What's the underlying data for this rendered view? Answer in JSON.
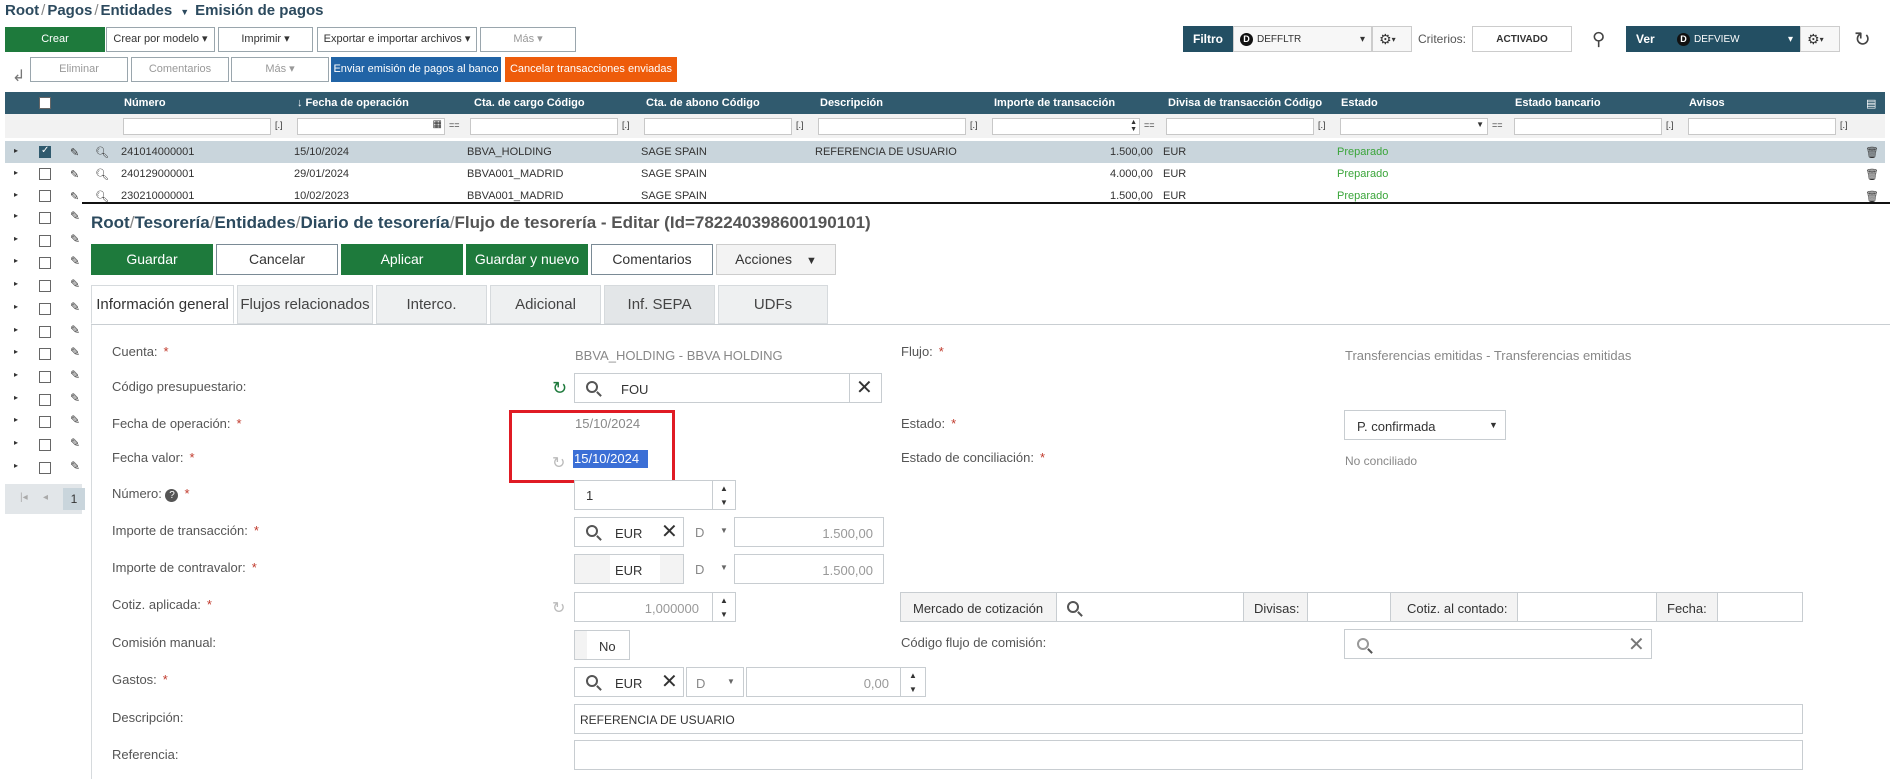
{
  "top_window": {
    "breadcrumb": [
      "Root",
      "Pagos",
      "Entidades",
      "Emisión de pagos"
    ],
    "toolbar1": {
      "crear": "Crear",
      "crear_modelo": "Crear por modelo",
      "imprimir": "Imprimir",
      "exportar": "Exportar e importar archivos",
      "mas": "Más"
    },
    "toolbar2": {
      "eliminar": "Eliminar",
      "comentarios": "Comentarios",
      "mas": "Más",
      "enviar": "Enviar emisión de pagos al banco",
      "cancelar": "Cancelar transacciones enviadas"
    },
    "filter": {
      "label": "Filtro",
      "badge": "D",
      "value": "DEFFLTR",
      "criterios_label": "Criterios:",
      "criterios_value": "ACTIVADO"
    },
    "view": {
      "label": "Ver",
      "badge": "D",
      "value": "DEFVIEW"
    },
    "columns": [
      "Número",
      "↓ Fecha de operación",
      "Cta. de cargo Código",
      "Cta. de abono Código",
      "Descripción",
      "Importe de transacción",
      "Divisa de transacción Código",
      "Estado",
      "Estado bancario",
      "Avisos"
    ],
    "filter_ops": [
      "[.]",
      "=="
    ],
    "rows": [
      {
        "numero": "241014000001",
        "fecha": "15/10/2024",
        "cargo": "BBVA_HOLDING",
        "abono": "SAGE SPAIN",
        "desc": "REFERENCIA DE USUARIO",
        "importe": "1.500,00",
        "divisa": "EUR",
        "estado": "Preparado"
      },
      {
        "numero": "240129000001",
        "fecha": "29/01/2024",
        "cargo": "BBVA001_MADRID",
        "abono": "SAGE SPAIN",
        "desc": "",
        "importe": "4.000,00",
        "divisa": "EUR",
        "estado": "Preparado"
      },
      {
        "numero": "230210000001",
        "fecha": "10/02/2023",
        "cargo": "BBVA001_MADRID",
        "abono": "SAGE SPAIN",
        "desc": "",
        "importe": "1.500,00",
        "divisa": "EUR",
        "estado": "Preparado"
      }
    ],
    "pager": "1"
  },
  "editor": {
    "breadcrumb": [
      "Root",
      "Tesorería",
      "Entidades",
      "Diario de tesorería"
    ],
    "title": "Flujo de tesorería - Editar (Id=782240398600190101)",
    "actions": {
      "guardar": "Guardar",
      "cancelar": "Cancelar",
      "aplicar": "Aplicar",
      "guardar_nuevo": "Guardar y nuevo",
      "comentarios": "Comentarios",
      "acciones": "Acciones"
    },
    "tabs": [
      "Información general",
      "Flujos relacionados",
      "Interco.",
      "Adicional",
      "Inf. SEPA",
      "UDFs"
    ],
    "labels": {
      "cuenta": "Cuenta:",
      "presupuestario": "Código presupuestario:",
      "fecha_op": "Fecha de operación:",
      "fecha_valor": "Fecha valor:",
      "numero": "Número:",
      "importe_trans": "Importe de transacción:",
      "importe_contra": "Importe de contravalor:",
      "cotiz": "Cotiz. aplicada:",
      "comision": "Comisión manual:",
      "gastos": "Gastos:",
      "descripcion": "Descripción:",
      "referencia": "Referencia:",
      "flujo": "Flujo:",
      "estado": "Estado:",
      "estado_conc": "Estado de conciliación:",
      "mercado": "Mercado de cotización",
      "divisas": "Divisas:",
      "cotiz_contado": "Cotiz. al contado:",
      "fecha": "Fecha:",
      "codigo_comision": "Código flujo de comisión:"
    },
    "values": {
      "cuenta": "BBVA_HOLDING - BBVA HOLDING",
      "presupuestario": "FOU",
      "fecha_op": "15/10/2024",
      "fecha_valor": "15/10/2024",
      "numero": "1",
      "importe_divisa": "EUR",
      "importe_dc": "D",
      "importe_trans": "1.500,00",
      "importe_contra": "1.500,00",
      "cotiz": "1,000000",
      "comision": "No",
      "gastos_divisa": "EUR",
      "gastos_dc": "D",
      "gastos": "0,00",
      "descripcion": "REFERENCIA DE USUARIO",
      "referencia": "",
      "flujo": "Transferencias emitidas - Transferencias emitidas",
      "estado": "P. confirmada",
      "estado_conc": "No conciliado"
    }
  }
}
